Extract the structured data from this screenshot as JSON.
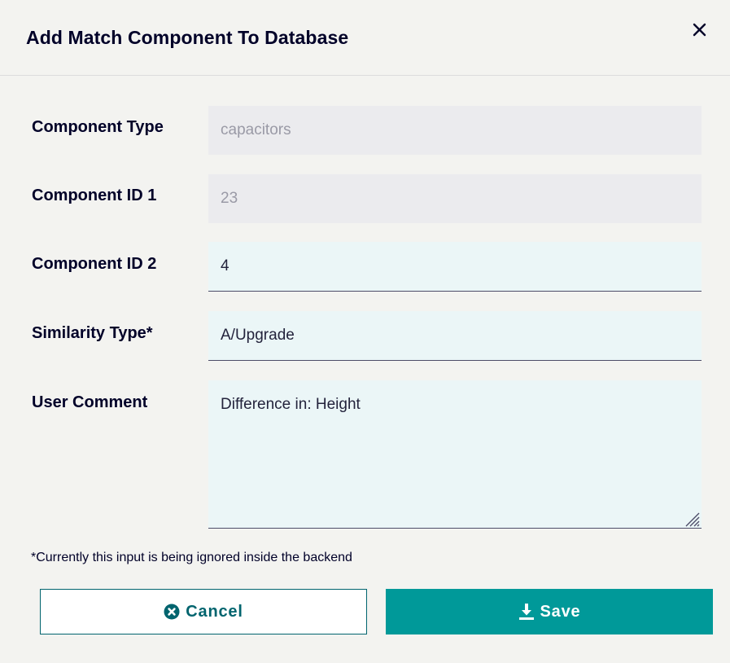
{
  "dialog": {
    "title": "Add Match Component To Database",
    "close_icon": "close-icon"
  },
  "form": {
    "component_type": {
      "label": "Component Type",
      "value": "capacitors",
      "disabled": true
    },
    "component_id_1": {
      "label": "Component ID 1",
      "value": "23",
      "disabled": true
    },
    "component_id_2": {
      "label": "Component ID 2",
      "value": "4"
    },
    "similarity_type": {
      "label": "Similarity Type*",
      "value": "A/Upgrade"
    },
    "user_comment": {
      "label": "User Comment",
      "value": "Difference in: Height"
    }
  },
  "note": "*Currently this input is being ignored inside the backend",
  "actions": {
    "cancel_label": "Cancel",
    "cancel_icon": "cancel-circle-icon",
    "save_label": "Save",
    "save_icon": "download-icon"
  },
  "colors": {
    "primary": "#009999",
    "primary_dark": "#00646e",
    "text": "#000028",
    "background": "#f3f3f0",
    "input_bg": "#ebf6f7",
    "disabled_bg": "#ebebee"
  }
}
